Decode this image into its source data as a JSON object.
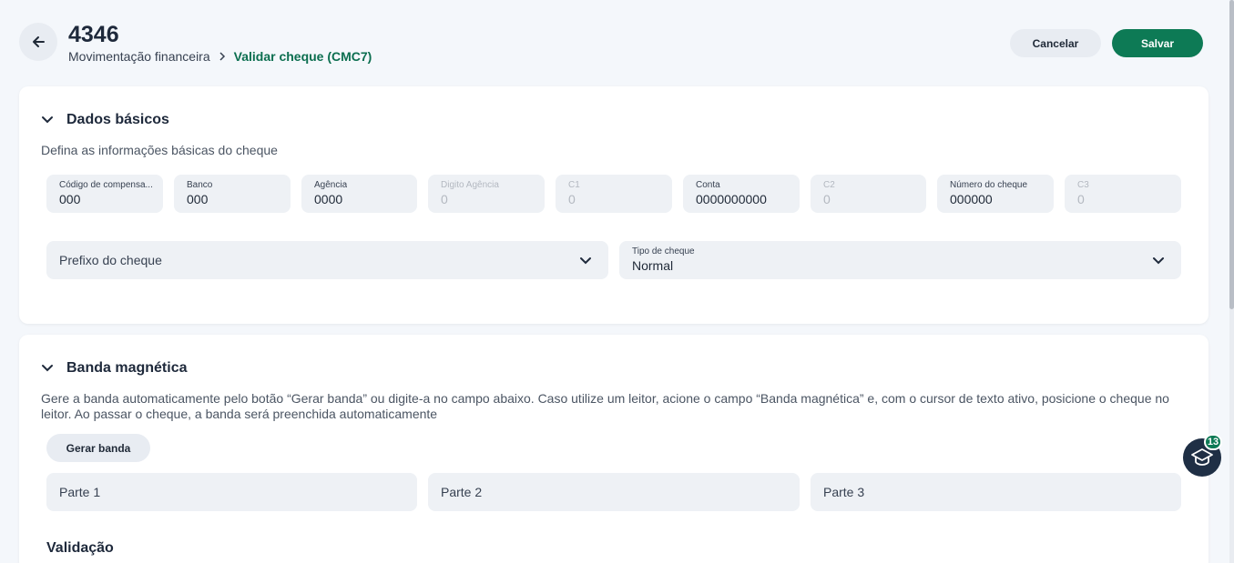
{
  "header": {
    "title": "4346",
    "breadcrumb_parent": "Movimentação financeira",
    "breadcrumb_current": "Validar cheque (CMC7)",
    "cancel_label": "Cancelar",
    "save_label": "Salvar"
  },
  "dados_basicos": {
    "title": "Dados básicos",
    "description": "Defina as informações básicas do cheque",
    "fields": [
      {
        "label": "Código de compensa...",
        "value": "000",
        "disabled": false
      },
      {
        "label": "Banco",
        "value": "000",
        "disabled": false
      },
      {
        "label": "Agência",
        "value": "0000",
        "disabled": false
      },
      {
        "label": "Digito Agência",
        "value": "0",
        "disabled": true
      },
      {
        "label": "C1",
        "value": "0",
        "disabled": true
      },
      {
        "label": "Conta",
        "value": "0000000000",
        "disabled": false
      },
      {
        "label": "C2",
        "value": "0",
        "disabled": true
      },
      {
        "label": "Número do cheque",
        "value": "000000",
        "disabled": false
      },
      {
        "label": "C3",
        "value": "0",
        "disabled": true
      }
    ],
    "prefixo_placeholder": "Prefixo do cheque",
    "tipo_label": "Tipo de cheque",
    "tipo_value": "Normal"
  },
  "banda": {
    "title": "Banda magnética",
    "description": "Gere a banda automaticamente pelo botão “Gerar banda” ou digite-a no campo abaixo. Caso utilize um leitor, acione o campo “Banda magnética” e, com o cursor de texto ativo, posicione o cheque no leitor. Ao passar o cheque, a banda será preenchida automaticamente",
    "gerar_label": "Gerar banda",
    "parts": [
      "Parte 1",
      "Parte 2",
      "Parte 3"
    ],
    "validation_heading": "Validação"
  },
  "academy": {
    "badge_count": "13",
    "icon": "graduation-cap-icon"
  },
  "colors": {
    "accent": "#0d7a55",
    "field_bg": "#eef1f5",
    "page_bg": "#f4f7fb"
  }
}
